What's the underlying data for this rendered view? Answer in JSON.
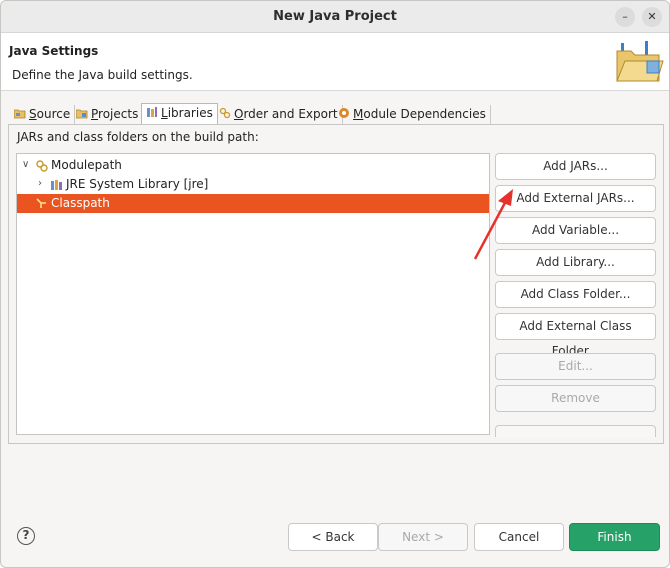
{
  "window": {
    "title": "New Java Project",
    "minimize_glyph": "–",
    "close_glyph": "✕"
  },
  "header": {
    "title": "Java Settings",
    "description": "Define the Java build settings."
  },
  "tabs": [
    {
      "label": "Source",
      "mnemonic": "S",
      "rest": "ource",
      "icon": "source-folder-icon"
    },
    {
      "label": "Projects",
      "mnemonic": "P",
      "rest": "rojects",
      "icon": "projects-icon"
    },
    {
      "label": "Libraries",
      "mnemonic": "L",
      "rest": "ibraries",
      "icon": "libraries-icon",
      "active": true
    },
    {
      "label": "Order and Export",
      "mnemonic": "O",
      "rest": "rder and Export",
      "icon": "order-export-icon"
    },
    {
      "label": "Module Dependencies",
      "mnemonic": "M",
      "rest": "odule Dependencies",
      "icon": "module-dependencies-icon"
    }
  ],
  "libraries": {
    "panel_label": "JARs and class folders on the build path:",
    "tree": [
      {
        "label": "Modulepath",
        "expanded": true,
        "level": 0
      },
      {
        "label": "JRE System Library [jre]",
        "expanded": false,
        "level": 1
      },
      {
        "label": "Classpath",
        "selected": true,
        "level": 0
      }
    ],
    "buttons": {
      "add_jars": "Add JARs...",
      "add_external_jars": "Add External JARs...",
      "add_variable": "Add Variable...",
      "add_library": "Add Library...",
      "add_class_folder": "Add Class Folder...",
      "add_external_class_folder": "Add External Class Folder...",
      "edit": "Edit...",
      "remove": "Remove"
    }
  },
  "footer": {
    "help": "?",
    "back": "< Back",
    "next": "Next >",
    "cancel": "Cancel",
    "finish": "Finish"
  },
  "colors": {
    "selection": "#e95420",
    "finish_button": "#26a269",
    "annotation_arrow": "#e5322d"
  }
}
